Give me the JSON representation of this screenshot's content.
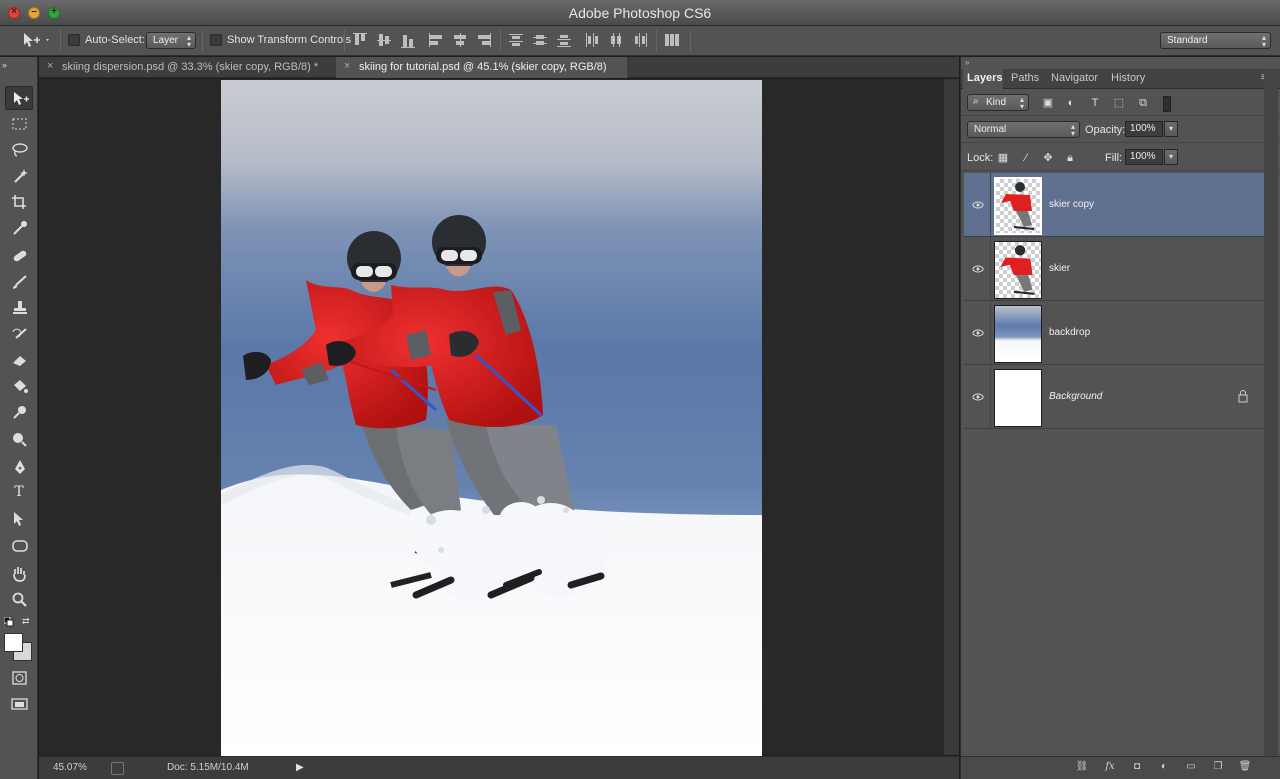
{
  "window": {
    "title": "Adobe Photoshop CS6"
  },
  "options_bar": {
    "auto_select_label": "Auto-Select:",
    "auto_select_value": "Layer",
    "transform_label": "Show Transform Controls",
    "workspace_value": "Standard"
  },
  "documents": {
    "tabs": [
      {
        "label": "skiing dispersion.psd @ 33.3% (skier copy, RGB/8) *",
        "active": false
      },
      {
        "label": "skiing for tutorial.psd @ 45.1% (skier copy, RGB/8)",
        "active": true
      }
    ]
  },
  "status": {
    "zoom": "45.07%",
    "doc_info": "Doc: 5.15M/10.4M"
  },
  "panel": {
    "tabs": [
      "Layers",
      "Paths",
      "Navigator",
      "History"
    ],
    "filter_kind": "Kind",
    "blend_mode": "Normal",
    "opacity_label": "Opacity:",
    "opacity_value": "100%",
    "lock_label": "Lock:",
    "fill_label": "Fill:",
    "fill_value": "100%"
  },
  "layers": [
    {
      "name": "skier copy",
      "selected": true,
      "thumb": "skier",
      "locked": false,
      "italic": false
    },
    {
      "name": "skier",
      "selected": false,
      "thumb": "skier",
      "locked": false,
      "italic": false
    },
    {
      "name": "backdrop",
      "selected": false,
      "thumb": "backdrop",
      "locked": false,
      "italic": false
    },
    {
      "name": "Background",
      "selected": false,
      "thumb": "white",
      "locked": true,
      "italic": true
    }
  ],
  "colors": {
    "selected_layer": "#5f7090",
    "sky": "#5a78a8",
    "jacket": "#e02020"
  }
}
